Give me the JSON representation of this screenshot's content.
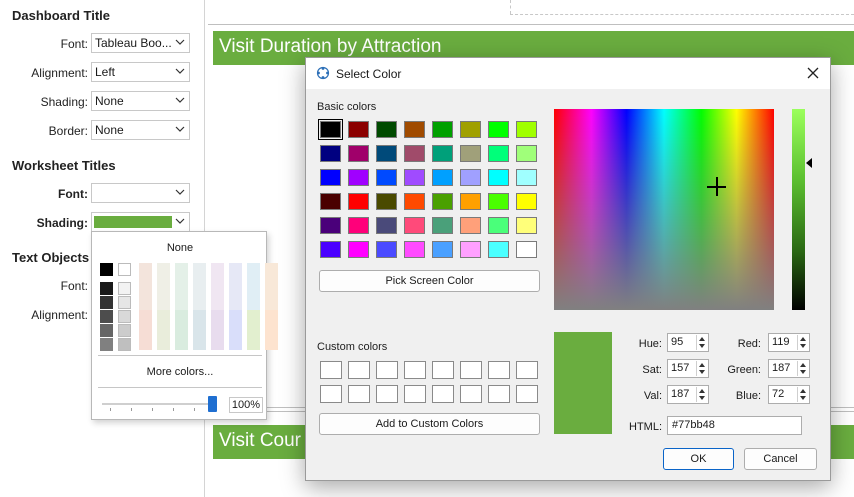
{
  "left_pane": {
    "dashboard_title_heading": "Dashboard Title",
    "font_label": "Font:",
    "font_value": "Tableau Boo...",
    "alignment_label": "Alignment:",
    "alignment_value": "Left",
    "shading_label": "Shading:",
    "shading_value": "None",
    "border_label": "Border:",
    "border_value": "None",
    "worksheet_titles_heading": "Worksheet Titles",
    "ws_font_label": "Font:",
    "ws_shading_label": "Shading:",
    "ws_shading_color": "#6aad3f",
    "text_objects_heading": "Text Objects",
    "to_font_label": "Font:",
    "to_alignment_label": "Alignment:"
  },
  "canvas": {
    "banner1": "Visit Duration by Attraction",
    "banner2": "Visit Cour",
    "banner_color": "#6aad3f"
  },
  "color_popup": {
    "none_label": "None",
    "more_colors": "More colors...",
    "opacity_value": "100%",
    "opacity_level": 1.0
  },
  "dialog": {
    "title": "Select Color",
    "basic_colors_label": "Basic colors",
    "pick_screen_color": "Pick Screen Color",
    "custom_colors_label": "Custom colors",
    "add_to_custom": "Add to Custom Colors",
    "hue_label": "Hue:",
    "hue": "95",
    "sat_label": "Sat:",
    "sat": "157",
    "val_label": "Val:",
    "val": "187",
    "red_label": "Red:",
    "red": "119",
    "green_label": "Green:",
    "green": "187",
    "blue_label": "Blue:",
    "blue": "72",
    "html_label": "HTML:",
    "html": "#77bb48",
    "ok": "OK",
    "cancel": "Cancel",
    "current_color": "#6aad3f",
    "basic_colors": [
      "#000000",
      "#8b0000",
      "#004a00",
      "#a04b00",
      "#00a000",
      "#a0a000",
      "#00ff00",
      "#a0ff00",
      "#000080",
      "#a0006a",
      "#004a7a",
      "#a04b6a",
      "#00a07a",
      "#a0a07a",
      "#00ff7a",
      "#a0ff7a",
      "#0000ff",
      "#a000ff",
      "#004aff",
      "#a04bff",
      "#00a0ff",
      "#a0a0ff",
      "#00ffff",
      "#a0ffff",
      "#4a0000",
      "#ff0000",
      "#4a4a00",
      "#ff4a00",
      "#4aa000",
      "#ffa000",
      "#4aff00",
      "#ffff00",
      "#4a007a",
      "#ff007a",
      "#4a4a7a",
      "#ff4a7a",
      "#4aa07a",
      "#ffa07a",
      "#4aff7a",
      "#ffff7a",
      "#4a00ff",
      "#ff00ff",
      "#4a4aff",
      "#ff4aff",
      "#4aa0ff",
      "#ffa0ff",
      "#4affff",
      "#ffffff"
    ]
  }
}
